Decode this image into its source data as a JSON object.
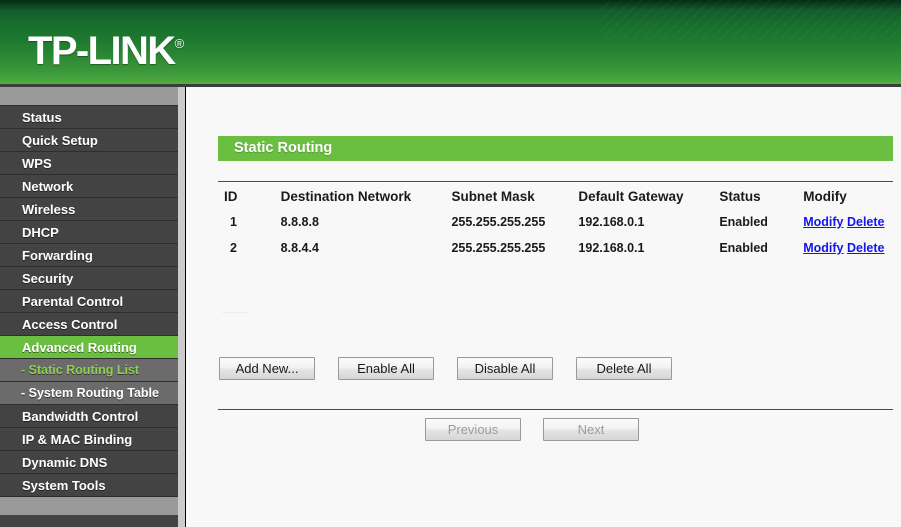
{
  "brand": {
    "name": "TP-LINK",
    "registered_mark": "®"
  },
  "colors": {
    "header_green_dark": "#0c4a1e",
    "header_green_light": "#57ad45",
    "accent_green": "#6abf40",
    "active_sub_text": "#8ed04f",
    "rule_green": "#1a6640",
    "link_blue": "#1414ee",
    "sidebar_bg": "#434343",
    "sidebar_sub_bg": "#6b6b6b",
    "sidebar_bar": "#9a9a9a"
  },
  "sidebar": {
    "items": [
      {
        "label": "Status",
        "type": "main",
        "state": "normal"
      },
      {
        "label": "Quick Setup",
        "type": "main",
        "state": "normal"
      },
      {
        "label": "WPS",
        "type": "main",
        "state": "normal"
      },
      {
        "label": "Network",
        "type": "main",
        "state": "normal"
      },
      {
        "label": "Wireless",
        "type": "main",
        "state": "normal"
      },
      {
        "label": "DHCP",
        "type": "main",
        "state": "normal"
      },
      {
        "label": "Forwarding",
        "type": "main",
        "state": "normal"
      },
      {
        "label": "Security",
        "type": "main",
        "state": "normal"
      },
      {
        "label": "Parental Control",
        "type": "main",
        "state": "normal"
      },
      {
        "label": "Access Control",
        "type": "main",
        "state": "normal"
      },
      {
        "label": "Advanced Routing",
        "type": "main",
        "state": "active"
      },
      {
        "label": "- Static Routing List",
        "type": "sub",
        "state": "active-sub"
      },
      {
        "label": "- System Routing Table",
        "type": "sub",
        "state": "normal"
      },
      {
        "label": "Bandwidth Control",
        "type": "main",
        "state": "normal"
      },
      {
        "label": "IP & MAC Binding",
        "type": "main",
        "state": "normal"
      },
      {
        "label": "Dynamic DNS",
        "type": "main",
        "state": "normal"
      },
      {
        "label": "System Tools",
        "type": "main",
        "state": "normal"
      }
    ]
  },
  "main": {
    "page_title": "Static Routing",
    "table": {
      "headers": [
        "ID",
        "Destination Network",
        "Subnet Mask",
        "Default Gateway",
        "Status",
        "Modify"
      ],
      "rows": [
        {
          "id": "1",
          "destination_network": "8.8.8.8",
          "subnet_mask": "255.255.255.255",
          "default_gateway": "192.168.0.1",
          "status": "Enabled",
          "modify_label": "Modify",
          "delete_label": "Delete"
        },
        {
          "id": "2",
          "destination_network": "8.8.4.4",
          "subnet_mask": "255.255.255.255",
          "default_gateway": "192.168.0.1",
          "status": "Enabled",
          "modify_label": "Modify",
          "delete_label": "Delete"
        }
      ]
    },
    "actions": {
      "add_new": "Add New...",
      "enable_all": "Enable All",
      "disable_all": "Disable All",
      "delete_all": "Delete All"
    },
    "pagination": {
      "previous": "Previous",
      "next": "Next",
      "previous_enabled": false,
      "next_enabled": false
    }
  }
}
